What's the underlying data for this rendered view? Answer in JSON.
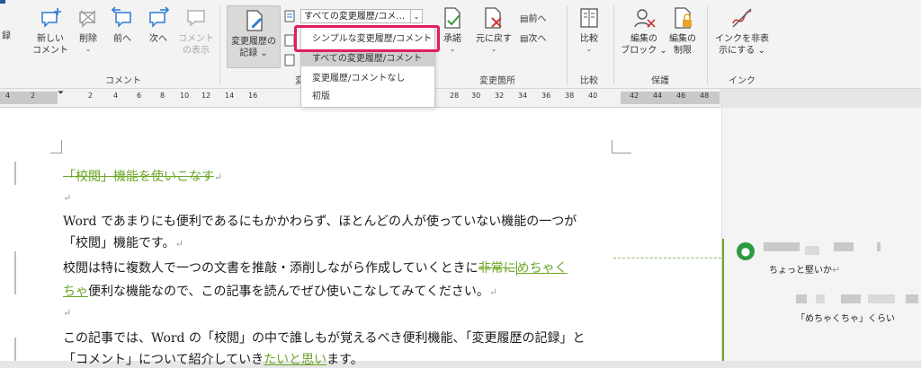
{
  "ribbon": {
    "left_partial": "録",
    "comment_group": {
      "label": "コメント",
      "new": {
        "line1": "新しい",
        "line2": "コメント"
      },
      "delete": "削除",
      "prev": "前へ",
      "next": "次へ",
      "show": {
        "line1": "コメント",
        "line2": "の表示"
      }
    },
    "tracking_group": {
      "label_partial": "変",
      "track": {
        "line1": "変更履歴の",
        "line2": "記録"
      },
      "display_combo": "すべての変更履歴/コメ…"
    },
    "changes_group": {
      "label": "変更箇所",
      "accept": "承諾",
      "reject": "元に戻す",
      "prev": "前へ",
      "next": "次へ"
    },
    "compare_group": {
      "label": "比較",
      "compare": "比較"
    },
    "protect_group": {
      "label": "保護",
      "block": {
        "line1": "編集の",
        "line2": "ブロック"
      },
      "restrict": {
        "line1": "編集の",
        "line2": "制限"
      }
    },
    "ink_group": {
      "label": "インク",
      "hide_ink": {
        "line1": "インクを非表",
        "line2": "示にする"
      }
    }
  },
  "dropdown": {
    "items": [
      "シンプルな変更履歴/コメント",
      "すべての変更履歴/コメント",
      "変更履歴/コメントなし",
      "初版"
    ],
    "selected_index": 1,
    "highlighted_index": 0
  },
  "ruler": {
    "ticks": [
      "4",
      "2",
      "2",
      "4",
      "6",
      "8",
      "10",
      "12",
      "14",
      "16",
      "28",
      "30",
      "32",
      "34",
      "36",
      "38",
      "40",
      "42",
      "44",
      "46",
      "48"
    ]
  },
  "document": {
    "title_deleted": "「校閲」機能を使いこなす",
    "p1": "Word であまりにも便利であるにもかかわらず、ほとんどの人が使っていない機能の一つが",
    "p1b": "「校閲」機能です。",
    "p2_a": "校閲は特に複数人で一つの文書を推敲・添削しながら作成していくときに",
    "p2_del": "非常に",
    "p2_ins1": "めちゃく",
    "p2_ins2": "ちゃ",
    "p2_b": "便利な機能なので、この記事を読んでぜひ使いこなしてみてください。",
    "p3": "この記事では、Word の「校閲」の中で誰しもが覚えるべき便利機能、「変更履歴の記録」と",
    "p3b_a": "「コメント」について紹介していき",
    "p3b_ins": "たいと思い",
    "p3b_b": "ます。",
    "para_mark": "↵"
  },
  "comments": [
    {
      "text": "ちょっと堅いか"
    },
    {
      "text": "「めちゃくちゃ」くらい"
    }
  ],
  "colors": {
    "accent": "#e31c5f",
    "insert": "#6aa624",
    "avatar": "#2e9a3f"
  }
}
